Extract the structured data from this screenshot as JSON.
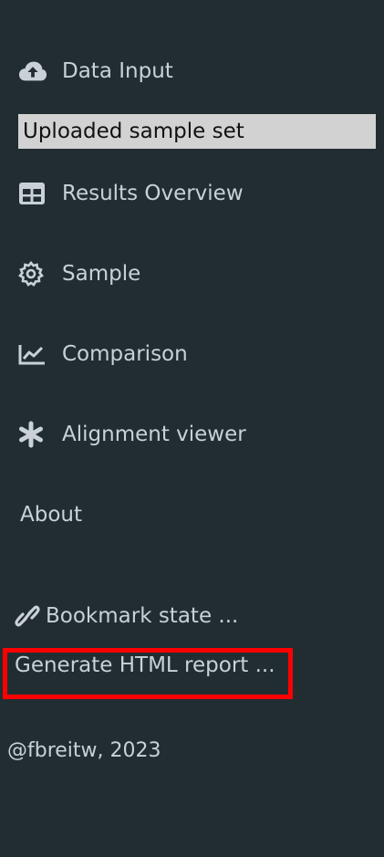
{
  "sidebar": {
    "items": [
      {
        "label": "Data Input",
        "icon": "cloud-upload-icon"
      },
      {
        "label": "Results Overview",
        "icon": "table-icon"
      },
      {
        "label": "Sample",
        "icon": "gear-icon"
      },
      {
        "label": "Comparison",
        "icon": "chart-line-icon"
      },
      {
        "label": "Alignment viewer",
        "icon": "asterisk-icon"
      },
      {
        "label": "About",
        "icon": ""
      }
    ],
    "data_input_value": "Uploaded sample set"
  },
  "actions": {
    "bookmark_label": "Bookmark state ...",
    "generate_report_label": "Generate HTML report ..."
  },
  "footer": {
    "text": "@fbreitw, 2023"
  },
  "colors": {
    "background": "#222d32",
    "text": "#c9d1d6",
    "input_background": "#d2d2d2",
    "highlight": "#ff0000"
  }
}
